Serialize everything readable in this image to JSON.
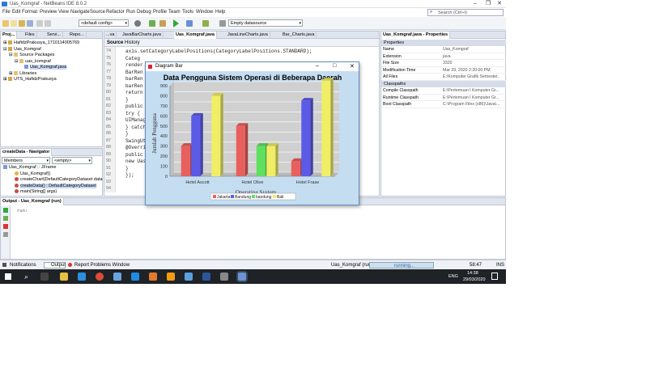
{
  "window": {
    "title": "Uas_Komgraf - NetBeans IDE 8.0.2"
  },
  "menu": [
    "File",
    "Edit",
    "Format",
    "Preview",
    "View",
    "Navigate",
    "Source",
    "Refactor",
    "Run",
    "Debug",
    "Profile",
    "Team",
    "Tools",
    "Window",
    "Help"
  ],
  "search": {
    "placeholder": "Search (Ctrl+I)"
  },
  "toolbar": {
    "config": "<default config>",
    "datasource": "Empty datasource"
  },
  "projects": {
    "tabs": [
      "Proj...",
      "Files",
      "Servi...",
      "Repo..."
    ],
    "items": [
      "HafidzPrakusya_1710114005769",
      "Uas_Komgraf",
      "Source Packages",
      "uas_komgraf",
      "Uas_Komgraf.java",
      "Libraries",
      "UTS_HafidzPrakusya"
    ]
  },
  "editor": {
    "tabs": [
      "...va",
      "JavaBarCharts.java",
      "Uas_Komgraf.java",
      "JavaLineCharts.java",
      "Bar_Charts.java"
    ],
    "subtabs": [
      "Source",
      "History"
    ],
    "lines": [
      {
        "n": "74",
        "code": "axis.setCategoryLabelPositions(CategoryLabelPositions.STANDARD);"
      },
      {
        "n": "75",
        "code": "Categ"
      },
      {
        "n": "76",
        "code": "render"
      },
      {
        "n": "77",
        "code": "BarRen"
      },
      {
        "n": "78",
        "code": "barRen"
      },
      {
        "n": "79",
        "code": "barRen"
      },
      {
        "n": "80",
        "code": "return"
      },
      {
        "n": "81",
        "code": "}"
      },
      {
        "n": "82",
        "code": "public"
      },
      {
        "n": "83",
        "code": "try {"
      },
      {
        "n": "84",
        "code": "UIManag"
      },
      {
        "n": "85",
        "code": "} catch"
      },
      {
        "n": "86",
        "code": "}"
      },
      {
        "n": "87",
        "code": "SwingUt"
      },
      {
        "n": "88",
        "code": "@Overri"
      },
      {
        "n": "89",
        "code": "public"
      },
      {
        "n": "90",
        "code": "new Uas"
      },
      {
        "n": "91",
        "code": "}"
      },
      {
        "n": "92",
        "code": "});"
      },
      {
        "n": "93",
        "code": ""
      },
      {
        "n": "94",
        "code": ""
      }
    ]
  },
  "properties": {
    "title": "Uas_Komgraf.java - Properties",
    "group1": "Properties",
    "rows": [
      {
        "k": "Name",
        "v": "Uas_Komgraf"
      },
      {
        "k": "Extension",
        "v": "java"
      },
      {
        "k": "File Size",
        "v": "3320"
      },
      {
        "k": "Modification Time",
        "v": "Mar 29, 2020 2:20:00 PM"
      },
      {
        "k": "All Files",
        "v": "E:\\Komputer Grafik Semester..."
      }
    ],
    "group2": "Classpaths",
    "rows2": [
      {
        "k": "Compile Classpath",
        "v": "E:\\Pertemuan I Komputer Gr..."
      },
      {
        "k": "Runtime Classpath",
        "v": "E:\\Pertemuan I Komputer Gr..."
      },
      {
        "k": "Boot Classpath",
        "v": "C:\\Program Files (x86)\\Java\\..."
      }
    ]
  },
  "navigator": {
    "title": "createData - Navigator",
    "members": "Members",
    "empty": "<empty>",
    "items": [
      "Uas_Komgraf :: JFrame",
      "Uas_Komgraf()",
      "createChart(DefaultCategoryDataset data",
      "createData() : DefaultCategoryDataset",
      "main(String[] args)"
    ]
  },
  "output": {
    "title": "Output - Uas_Komgraf (run)",
    "text": "run:"
  },
  "status": {
    "notifications": "Notifications",
    "output": "Output",
    "report": "Report Problems Window",
    "project": "Uas_Komgraf (run)",
    "running": "running...",
    "position": "58:47",
    "mode": "INS"
  },
  "taskbar": {
    "time": "14:38",
    "date": "29/03/2020",
    "lang": "ENG"
  },
  "dialog": {
    "title": "Diagram Bar"
  },
  "chart_data": {
    "type": "bar",
    "title": "Data Pengguna Sistem Operasi di Beberapa Daerah",
    "xlabel": "Operating System",
    "ylabel": "Jumlah Pengguna",
    "categories": [
      "Hotel Ascott",
      "Hotel Olive",
      "Hotel Frase"
    ],
    "ylim": [
      0,
      900
    ],
    "yticks": [
      0,
      100,
      200,
      300,
      400,
      500,
      600,
      700,
      800,
      900
    ],
    "series": [
      {
        "name": "Jakarta",
        "color": "#e8605e",
        "values": [
          300,
          500,
          150
        ]
      },
      {
        "name": "Bandung",
        "color": "#5b5be8",
        "values": [
          600,
          0,
          750
        ]
      },
      {
        "name": "bandung",
        "color": "#5fe05f",
        "values": [
          0,
          300,
          0
        ]
      },
      {
        "name": "Bali",
        "color": "#f0ee66",
        "values": [
          800,
          300,
          950
        ]
      }
    ],
    "grid": true,
    "legend": "bottom"
  }
}
